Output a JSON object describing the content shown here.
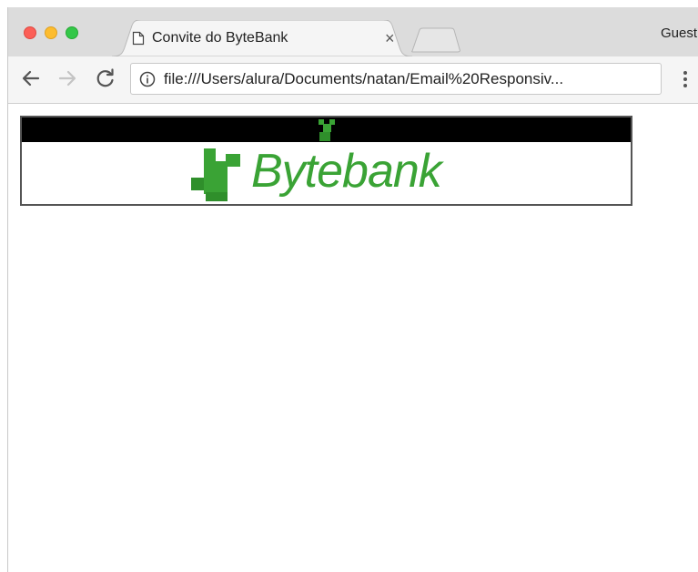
{
  "browser": {
    "tab": {
      "title": "Convite do ByteBank",
      "close_symbol": "×",
      "icon": "page-icon"
    },
    "profile_label": "Guest",
    "address_bar": {
      "url": "file:///Users/alura/Documents/natan/Email%20Responsiv...",
      "icon": "info-icon"
    },
    "nav": {
      "back_icon": "arrow-left-icon",
      "forward_icon": "arrow-right-icon",
      "reload_icon": "reload-icon",
      "menu_icon": "vertical-dots-icon"
    }
  },
  "email": {
    "header_bar_color": "#000000",
    "brand": {
      "name": "Bytebank",
      "color": "#3aa335"
    }
  }
}
